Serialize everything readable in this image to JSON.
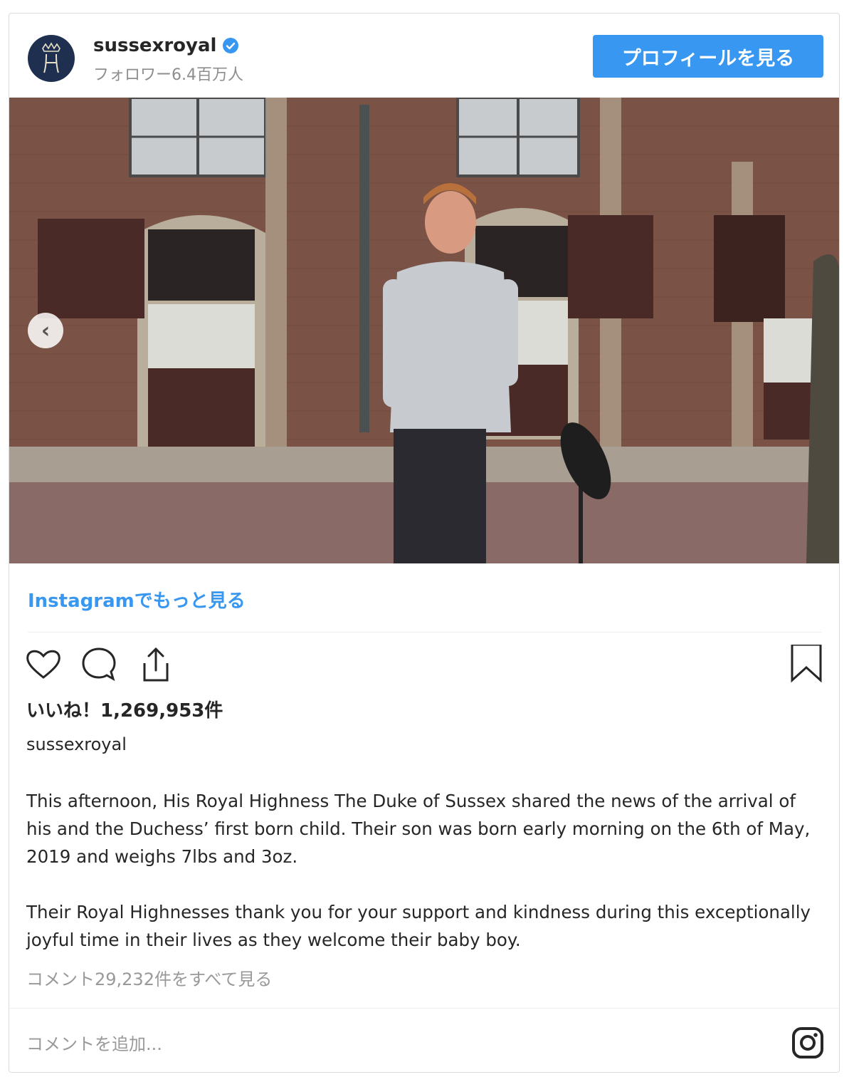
{
  "header": {
    "username": "sussexroyal",
    "followers": "フォロワー6.4百万人",
    "profile_button": "プロフィールを見る",
    "avatar_icon": "monogram-logo",
    "verified_icon": "verified-badge-icon"
  },
  "media": {
    "description_icon": "photo",
    "prev_icon": "chevron-left-icon"
  },
  "more_link": "Instagramでもっと見る",
  "actions": {
    "like_icon": "heart-icon",
    "comment_icon": "comment-icon",
    "share_icon": "share-icon",
    "save_icon": "bookmark-icon"
  },
  "likes": "いいね！1,269,953件",
  "caption": {
    "username": "sussexroyal",
    "paragraph1": "This afternoon, His Royal Highness The Duke of Sussex shared the news of the arrival of his and the Duchess’ first born child. Their son was born early morning on the 6th of May, 2019 and weighs 7lbs and 3oz.",
    "paragraph2": "Their Royal Highnesses thank you for your support and kindness during this exceptionally joyful time in their lives as they welcome their baby boy."
  },
  "view_comments": "コメント29,232件をすべて見る",
  "comment_placeholder": "コメントを追加...",
  "colors": {
    "accent": "#3897f0",
    "text": "#262626",
    "muted": "#8e8e8e",
    "avatar_bg": "#1f2f4f"
  }
}
